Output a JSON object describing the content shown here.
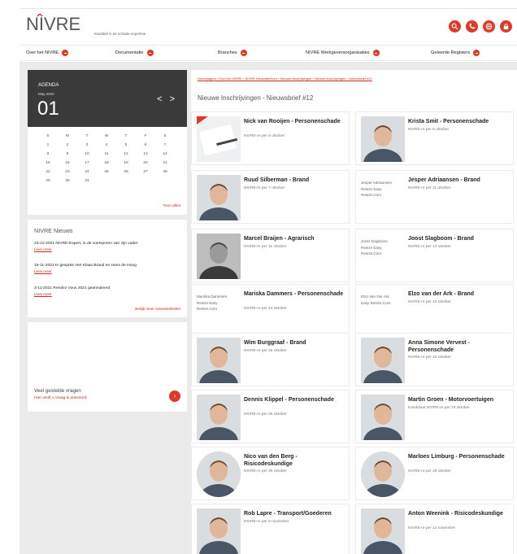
{
  "brand": {
    "logo_main": "NIVRE",
    "tagline": "Kwaliteit in de schade-expertise"
  },
  "header_icons": [
    "search-icon",
    "phone-icon",
    "globe-icon",
    "lock-icon"
  ],
  "nav": [
    "Over het NIVRE",
    "Documentatie",
    "Branches",
    "NIVRE Werkgeversorganisaties",
    "Geleerde Registers"
  ],
  "agenda": {
    "title": "AGENDA",
    "month": "May 2022",
    "day": "01",
    "arrows": "< >",
    "calendar": [
      "S",
      "M",
      "T",
      "W",
      "T",
      "F",
      "S",
      "1",
      "2",
      "3",
      "4",
      "5",
      "6",
      "7",
      "8",
      "9",
      "10",
      "11",
      "12",
      "13",
      "14",
      "15",
      "16",
      "17",
      "18",
      "19",
      "20",
      "21",
      "22",
      "23",
      "24",
      "25",
      "26",
      "27",
      "28",
      "29",
      "30",
      "31"
    ],
    "show_all": "Toon alles"
  },
  "news": {
    "title": "NIVRE Nieuws",
    "items": [
      {
        "text": "23-12-2021 NIVRE-Expert, in de voetsporen van zijn vader",
        "link": "Lees meer"
      },
      {
        "text": "15-11-2021 In gesprek met Klaas Brand en Hans de Hoog",
        "link": "Lees meer"
      },
      {
        "text": "3-11-2021 Rendez Vous 2021 geannuleerd",
        "link": "Lees meer"
      }
    ],
    "more": "Bekijk meer nieuwsartikelen"
  },
  "faq": {
    "question": "Veel gestelde vragen",
    "answer": "Hier vindt u vraag & antwoord"
  },
  "main": {
    "breadcrumb": "Homepagina › Over het NIVRE › NIVRE Nieuwsbrieven › Nieuwe inschrijvingen › Nieuwe inschrijvingen - Nieuwsbrief #12",
    "title": "Nieuwe Inschrijvingen - Nieuwsbrief #12",
    "cards": [
      {
        "name": "Nick van Rooijen - Personenschade",
        "sub": "NIVRE-re per 6 oktober",
        "photo": "document",
        "alt": ""
      },
      {
        "name": "Krista Smit - Personenschade",
        "sub": "NIVRE-re per 6 oktober",
        "photo": "person",
        "alt": ""
      },
      {
        "name": "Ruud Silberman - Brand",
        "sub": "NIVRE-re per 7 oktober",
        "photo": "person",
        "alt": ""
      },
      {
        "name": "Jesper Adriaansen - Brand",
        "sub": "NIVRE-re per 11 oktober",
        "photo": "none",
        "alt": "Jesper Adriaansen Resize Easy Resize.Com"
      },
      {
        "name": "Marcel Braijen - Agrarisch",
        "sub": "NIVRE-re per 11 oktober",
        "photo": "person-bw",
        "alt": ""
      },
      {
        "name": "Joost Slagboom - Brand",
        "sub": "NIVRE-re per 13 oktober",
        "photo": "none",
        "alt": "Joost Slagboom Resize Easy Resize.Com"
      },
      {
        "name": "Mariska Dammers - Personenschade",
        "sub": "NIVRE-re per 13 oktober",
        "photo": "none",
        "alt": "Mariska Dammers Resize Easy Resize.Com"
      },
      {
        "name": "Elzo van der Ark - Brand",
        "sub": "NIVRE-re per 13 oktober",
        "photo": "none",
        "alt": "Elzo Van Der Ark Easy Resize.Com"
      },
      {
        "name": "Wim Burggraaf - Brand",
        "sub": "NIVRE-re per 15 oktober",
        "photo": "person",
        "alt": ""
      },
      {
        "name": "Anna Simone Vervest - Personenschade",
        "sub": "NIVRE-re per 15 oktober",
        "photo": "person",
        "alt": ""
      },
      {
        "name": "Dennis Klippel - Personenschade",
        "sub": "NIVRE-re per 25 oktober",
        "photo": "person",
        "alt": ""
      },
      {
        "name": "Martin Groen - Motorvoertuigen",
        "sub": "Kandidaat NIVRE-re per 29 oktober",
        "photo": "person",
        "alt": ""
      },
      {
        "name": "Nico van den Berg - Risicodeskundige",
        "sub": "NIVRE-re per 29 oktober",
        "photo": "person-round",
        "alt": ""
      },
      {
        "name": "Marloes Limburg - Personenschade",
        "sub": "NIVRE-re per 29 oktober",
        "photo": "person-round",
        "alt": ""
      },
      {
        "name": "Rob Lapre - Transport/Goederen",
        "sub": "NIVRE-re per 8 november",
        "photo": "person",
        "alt": ""
      },
      {
        "name": "Anton Weenink - Risicodeskundige",
        "sub": "NIVRE-re per 12 november",
        "photo": "person",
        "alt": ""
      }
    ]
  }
}
